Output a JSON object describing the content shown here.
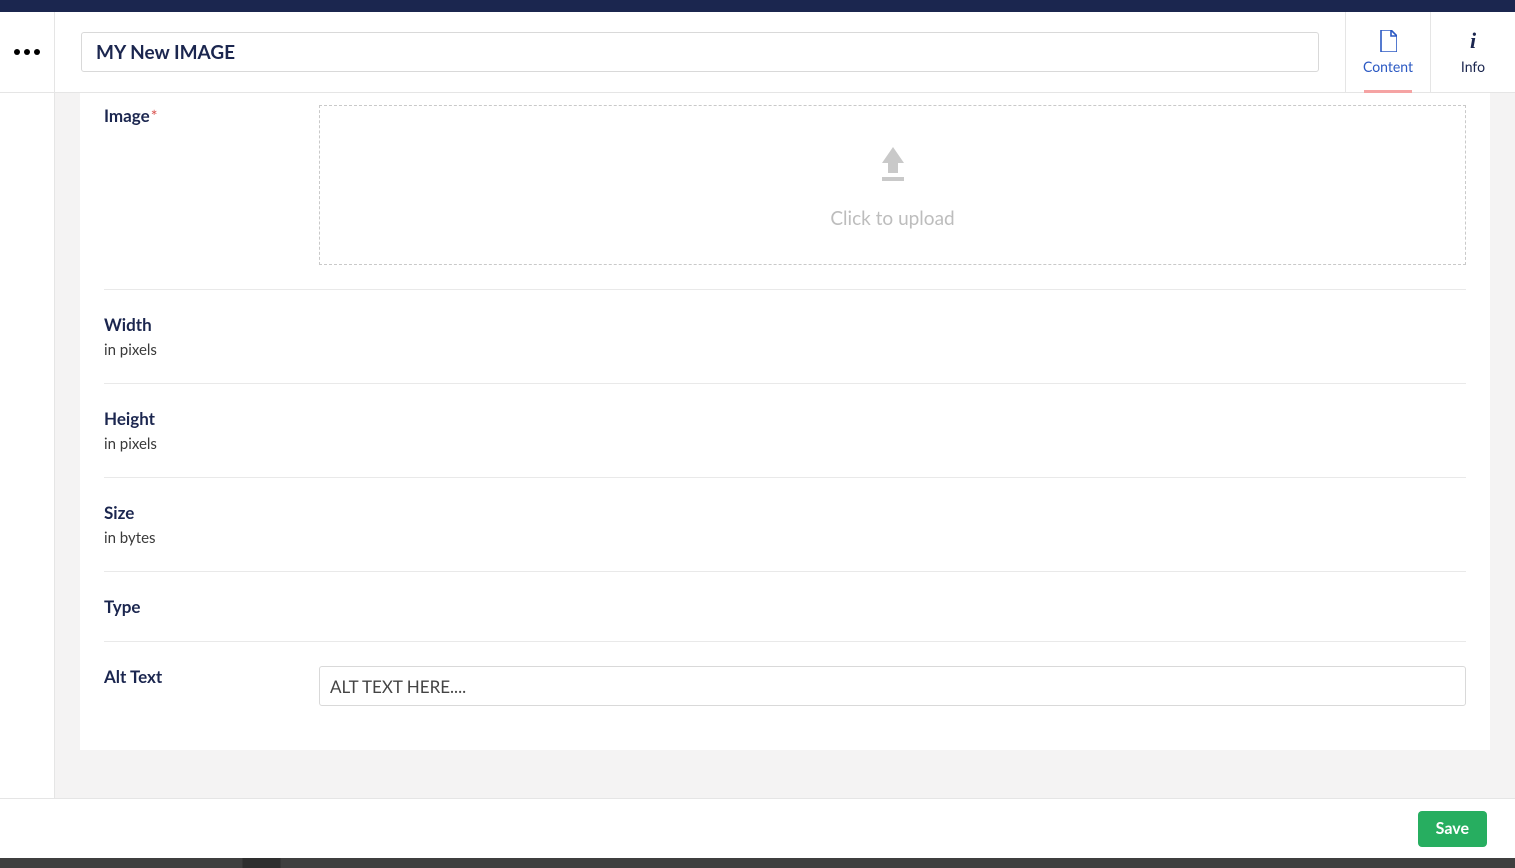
{
  "header": {
    "title_value": "MY New IMAGE",
    "tabs": {
      "content": "Content",
      "info": "Info"
    }
  },
  "fields": {
    "image": {
      "label": "Image",
      "required_marker": "*",
      "upload_prompt": "Click to upload"
    },
    "width": {
      "label": "Width",
      "hint": "in pixels"
    },
    "height": {
      "label": "Height",
      "hint": "in pixels"
    },
    "size": {
      "label": "Size",
      "hint": "in bytes"
    },
    "type": {
      "label": "Type"
    },
    "alt_text": {
      "label": "Alt Text",
      "value": "ALT TEXT HERE...."
    }
  },
  "footer": {
    "save_label": "Save"
  }
}
